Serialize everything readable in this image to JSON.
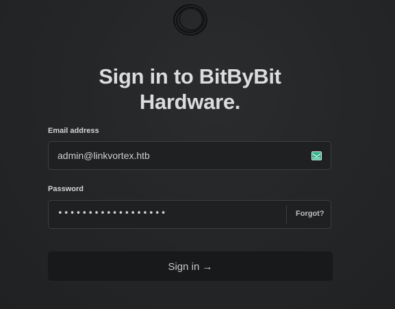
{
  "logo": {
    "icon": "ring-logo-icon"
  },
  "title": {
    "line1": "Sign in to BitByBit",
    "line2": "Hardware."
  },
  "email": {
    "label": "Email address",
    "value": "admin@linkvortex.htb",
    "icon": "mail-icon"
  },
  "password": {
    "label": "Password",
    "masked_value": "••••••••••••••••••",
    "forgot_label": "Forgot?"
  },
  "signin_button": {
    "label": "Sign in →"
  },
  "colors": {
    "background": "#242628",
    "input_background": "#1e2022",
    "input_border": "#3c3f42",
    "button_background": "#18191b",
    "mail_icon": "#2fb38c"
  }
}
